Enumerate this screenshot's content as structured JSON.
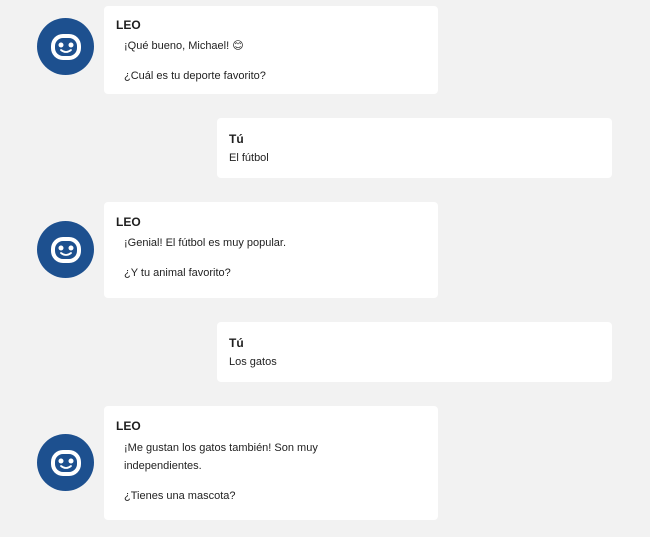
{
  "chat": {
    "messages": [
      {
        "sender": "LEO",
        "lines": [
          "¡Qué bueno, Michael! 😊",
          "¿Cuál es tu deporte favorito?"
        ]
      },
      {
        "sender": "Tú",
        "text": "El fútbol"
      },
      {
        "sender": "LEO",
        "lines": [
          "¡Genial! El fútbol es muy popular.",
          "¿Y tu animal favorito?"
        ]
      },
      {
        "sender": "Tú",
        "text": "Los gatos"
      },
      {
        "sender": "LEO",
        "lines": [
          "¡Me gustan los gatos también! Son muy independientes.",
          "¿Tienes una mascota?"
        ]
      }
    ],
    "bot_avatar_icon": "robot-face-icon",
    "colors": {
      "avatar_background": "#1d508f",
      "page_background": "#f2f2f2",
      "bubble_background": "#ffffff"
    }
  }
}
